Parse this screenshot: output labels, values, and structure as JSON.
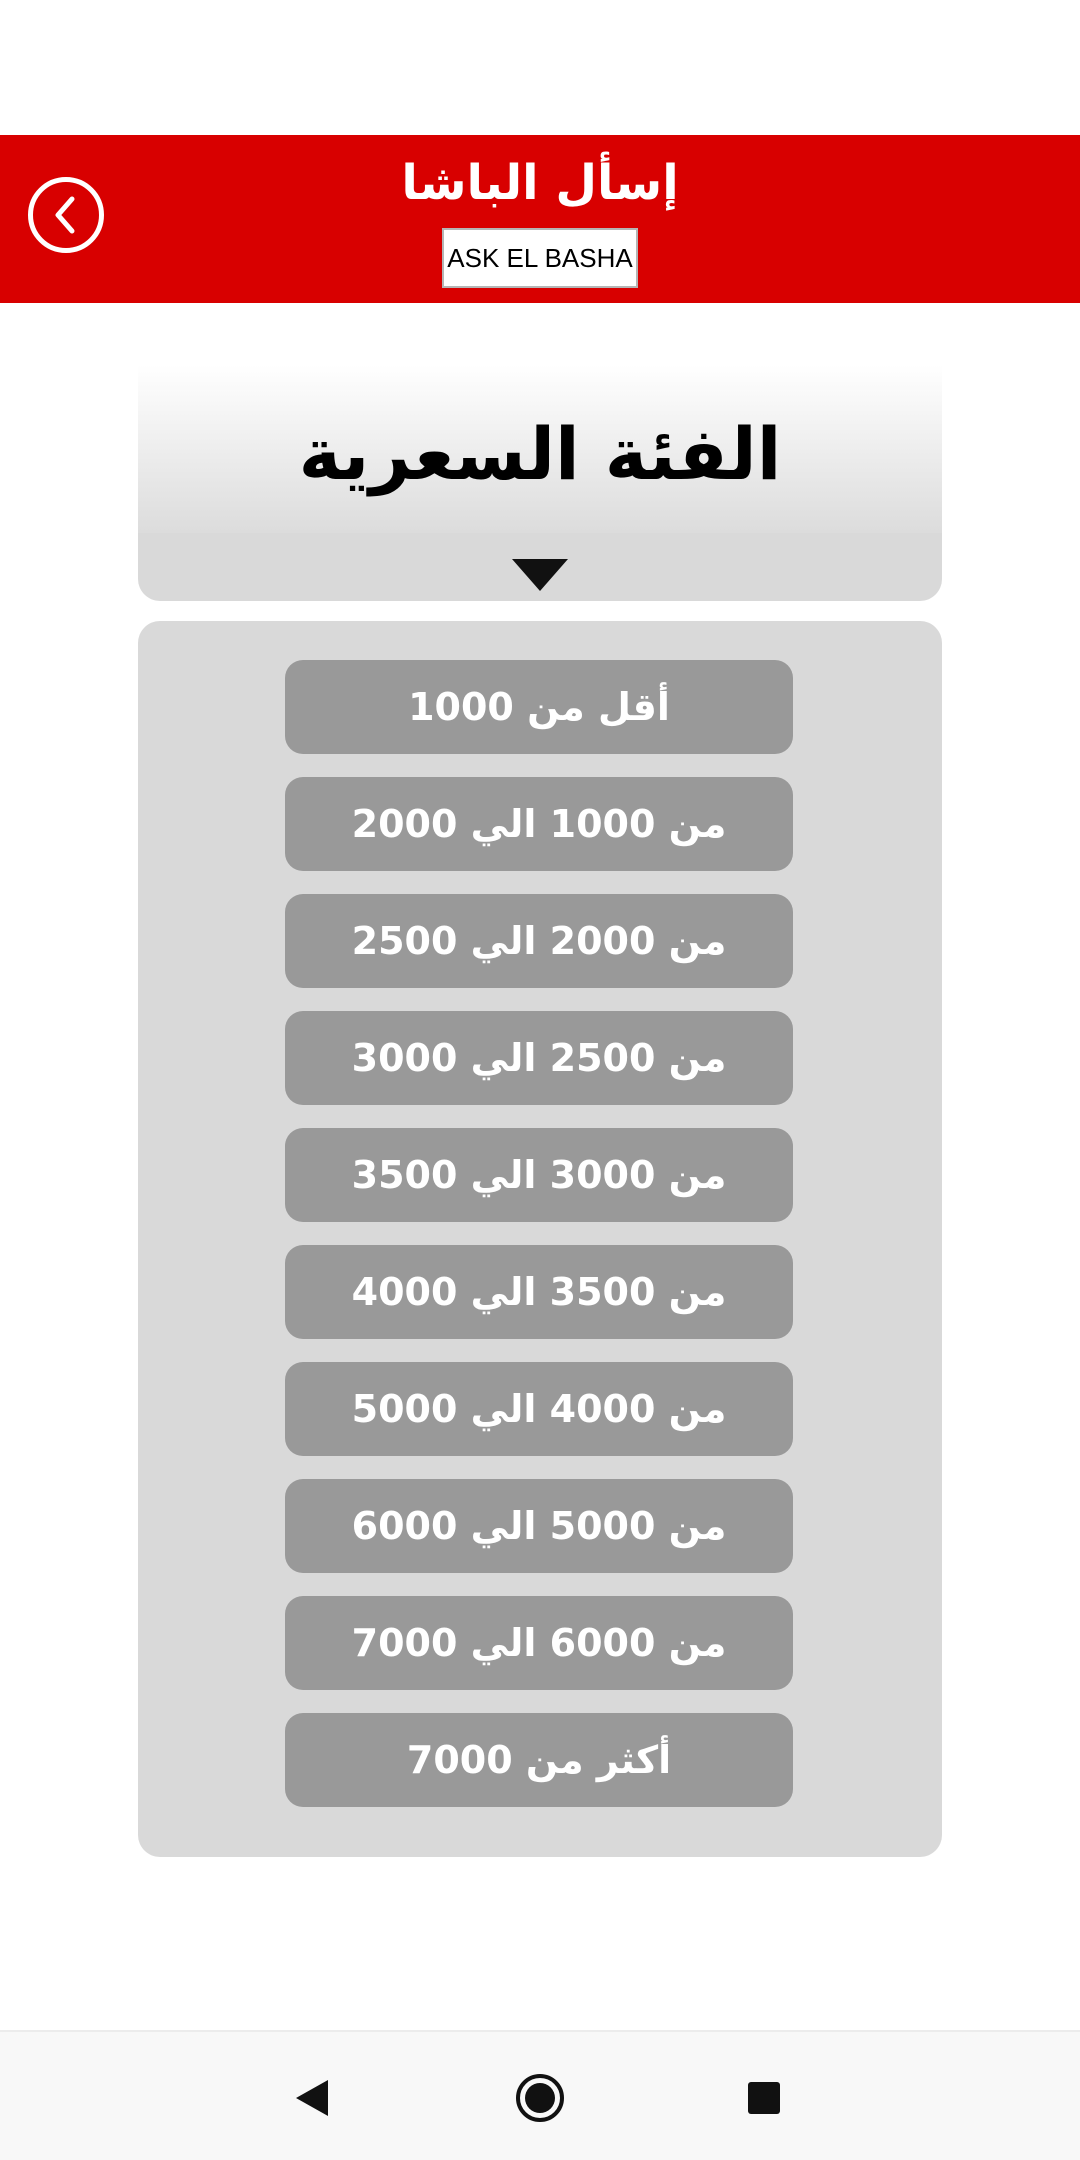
{
  "app_bar": {
    "title": "إسأل الباشا",
    "subtitle": "ASK EL BASHA",
    "color": "#d80000"
  },
  "section": {
    "title": "الفئة السعرية"
  },
  "options": [
    "أقل من 1000",
    "من 1000 الي 2000",
    "من 2000 الي 2500",
    "من 2500 الي 3000",
    "من 3000 الي 3500",
    "من 3500 الي 4000",
    "من 4000 الي 5000",
    "من 5000 الي 6000",
    "من 6000 الي 7000",
    "أكثر من 7000"
  ],
  "icons": {
    "back": "chevron-left-icon",
    "collapse": "triangle-down-icon",
    "nav_back": "triangle-back-icon",
    "nav_home": "circle-home-icon",
    "nav_recents": "square-recents-icon"
  }
}
